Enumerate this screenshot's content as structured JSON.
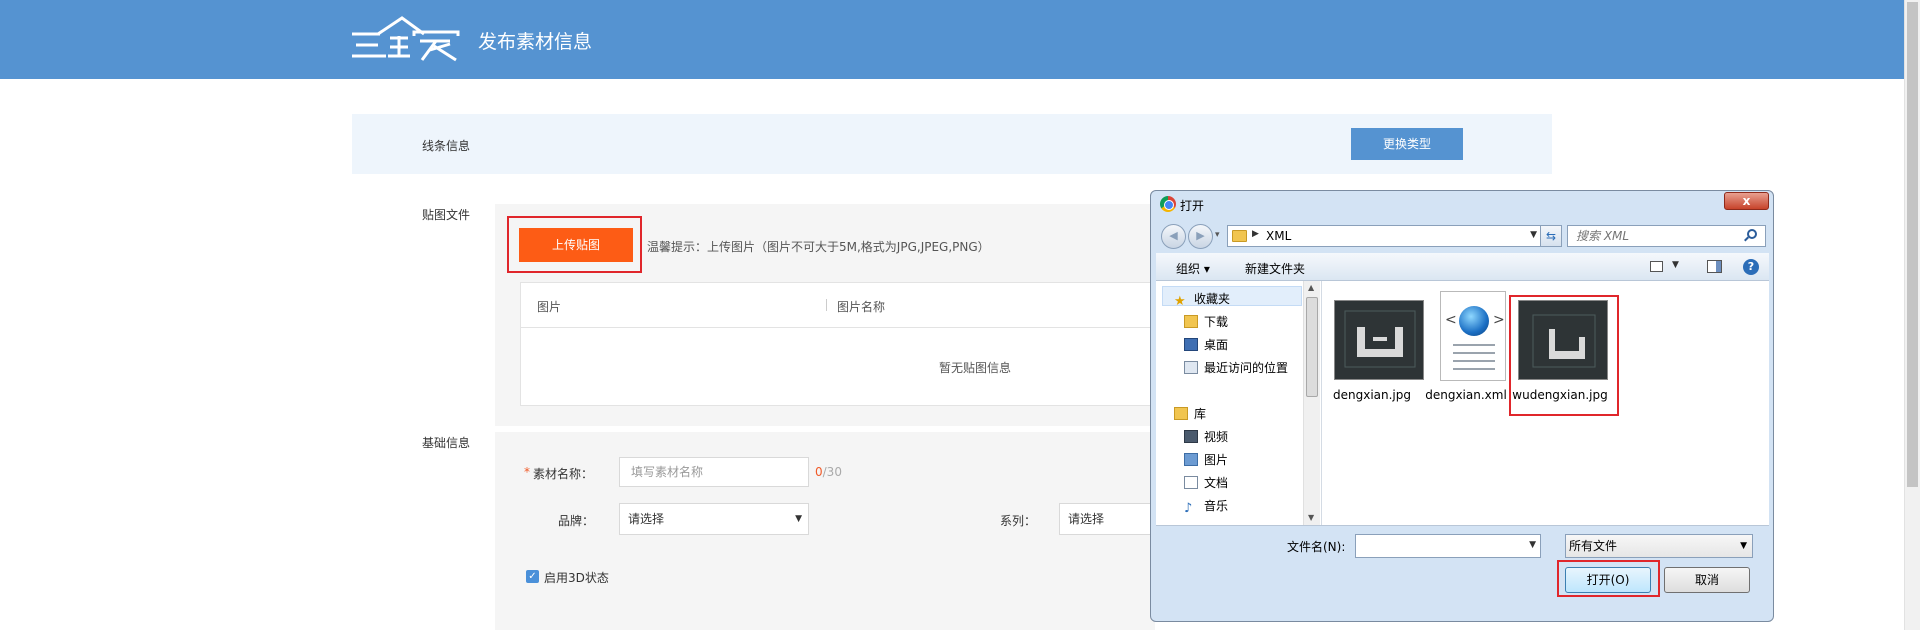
{
  "header": {
    "title": "发布素材信息",
    "logo_text": "三维家",
    "bg_color": "#5593d1"
  },
  "line_info": {
    "label": "线条信息",
    "change_type_button": "更换类型"
  },
  "texture": {
    "section_label": "贴图文件",
    "upload_button": "上传贴图",
    "tip": "温馨提示：上传图片（图片不可大于5M,格式为JPG,JPEG,PNG）",
    "columns": [
      "图片",
      "图片名称"
    ],
    "empty_text": "暂无贴图信息"
  },
  "basic": {
    "section_label": "基础信息",
    "name_label": "素材名称：",
    "name_placeholder": "填写素材名称",
    "counter_current": "0",
    "counter_max": "/30",
    "brand_label": "品牌：",
    "brand_value": "请选择",
    "series_label": "系列：",
    "series_value": "请选择",
    "enable_3d_label": "启用3D状态",
    "enable_3d_checked": true
  },
  "dialog": {
    "title": "打开",
    "close_label": "x",
    "address": "XML",
    "search_placeholder": "搜索 XML",
    "organize_label": "组织 ▾",
    "new_folder_label": "新建文件夹",
    "nav": {
      "favorites": "收藏夹",
      "download": "下载",
      "desktop": "桌面",
      "recent": "最近访问的位置",
      "libraries": "库",
      "videos": "视频",
      "pictures": "图片",
      "documents": "文档",
      "music": "音乐"
    },
    "files": [
      "dengxian.jpg",
      "dengxian.xml",
      "wudengxian.jpg"
    ],
    "filename_label": "文件名(N):",
    "filetype_value": "所有文件",
    "open_button": "打开(O)",
    "cancel_button": "取消"
  },
  "colors": {
    "accent": "#5593d1",
    "upload": "#fd5c15",
    "highlight": "#e0262b"
  }
}
